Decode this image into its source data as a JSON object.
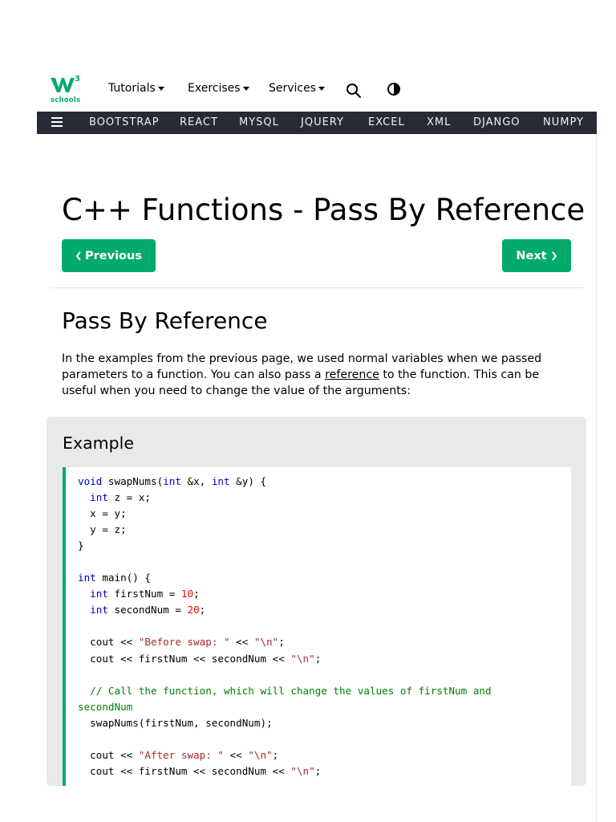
{
  "header": {
    "logo": {
      "mark": "w",
      "superscript": "3",
      "wordmark": "schools"
    },
    "menu": [
      {
        "label": "Tutorials"
      },
      {
        "label": "Exercises"
      },
      {
        "label": "Services"
      }
    ],
    "icons": [
      "search-icon",
      "theme-toggle-icon"
    ]
  },
  "navbar": {
    "links": [
      "BOOTSTRAP",
      "REACT",
      "MYSQL",
      "JQUERY",
      "EXCEL",
      "XML",
      "DJANGO",
      "NUMPY"
    ]
  },
  "page": {
    "title": "C++ Functions - Pass By Reference",
    "prev_label": "Previous",
    "next_label": "Next",
    "section_title": "Pass By Reference",
    "intro_before": "In the examples from the previous page, we used normal variables when we passed parameters to a function. You can also pass a ",
    "intro_link": "reference",
    "intro_after": " to the function. This can be useful when you need to change the value of the arguments:"
  },
  "example": {
    "title": "Example",
    "code_lines": [
      [
        [
          "kw",
          "void"
        ],
        [
          "t",
          " swapNums("
        ],
        [
          "kw",
          "int"
        ],
        [
          "t",
          " &x, "
        ],
        [
          "kw",
          "int"
        ],
        [
          "t",
          " &y) {"
        ]
      ],
      [
        [
          "t",
          "  "
        ],
        [
          "kw",
          "int"
        ],
        [
          "t",
          " z = x;"
        ]
      ],
      [
        [
          "t",
          "  x = y;"
        ]
      ],
      [
        [
          "t",
          "  y = z;"
        ]
      ],
      [
        [
          "t",
          "}"
        ]
      ],
      [
        [
          "t",
          ""
        ]
      ],
      [
        [
          "kw",
          "int"
        ],
        [
          "t",
          " main() {"
        ]
      ],
      [
        [
          "t",
          "  "
        ],
        [
          "kw",
          "int"
        ],
        [
          "t",
          " firstNum = "
        ],
        [
          "num",
          "10"
        ],
        [
          "t",
          ";"
        ]
      ],
      [
        [
          "t",
          "  "
        ],
        [
          "kw",
          "int"
        ],
        [
          "t",
          " secondNum = "
        ],
        [
          "num",
          "20"
        ],
        [
          "t",
          ";"
        ]
      ],
      [
        [
          "t",
          ""
        ]
      ],
      [
        [
          "t",
          "  cout << "
        ],
        [
          "str",
          "\"Before swap: \""
        ],
        [
          "t",
          " << "
        ],
        [
          "str",
          "\"\\n\""
        ],
        [
          "t",
          ";"
        ]
      ],
      [
        [
          "t",
          "  cout << firstNum << secondNum << "
        ],
        [
          "str",
          "\"\\n\""
        ],
        [
          "t",
          ";"
        ]
      ],
      [
        [
          "t",
          ""
        ]
      ],
      [
        [
          "t",
          "  "
        ],
        [
          "cm",
          "// Call the function, which will change the values of firstNum and"
        ]
      ],
      [
        [
          "cm",
          "secondNum"
        ]
      ],
      [
        [
          "t",
          "  swapNums(firstNum, secondNum);"
        ]
      ],
      [
        [
          "t",
          ""
        ]
      ],
      [
        [
          "t",
          "  cout << "
        ],
        [
          "str",
          "\"After swap: \""
        ],
        [
          "t",
          " << "
        ],
        [
          "str",
          "\"\\n\""
        ],
        [
          "t",
          ";"
        ]
      ],
      [
        [
          "t",
          "  cout << firstNum << secondNum << "
        ],
        [
          "str",
          "\"\\n\""
        ],
        [
          "t",
          ";"
        ]
      ]
    ]
  },
  "colors": {
    "brand_green": "#04AA6D",
    "navbar_bg": "#282A35",
    "example_bg": "#E7E9EB",
    "keyword": "#0000cd",
    "number": "#ff0000",
    "string": "#a52a2a",
    "comment": "#008000"
  }
}
